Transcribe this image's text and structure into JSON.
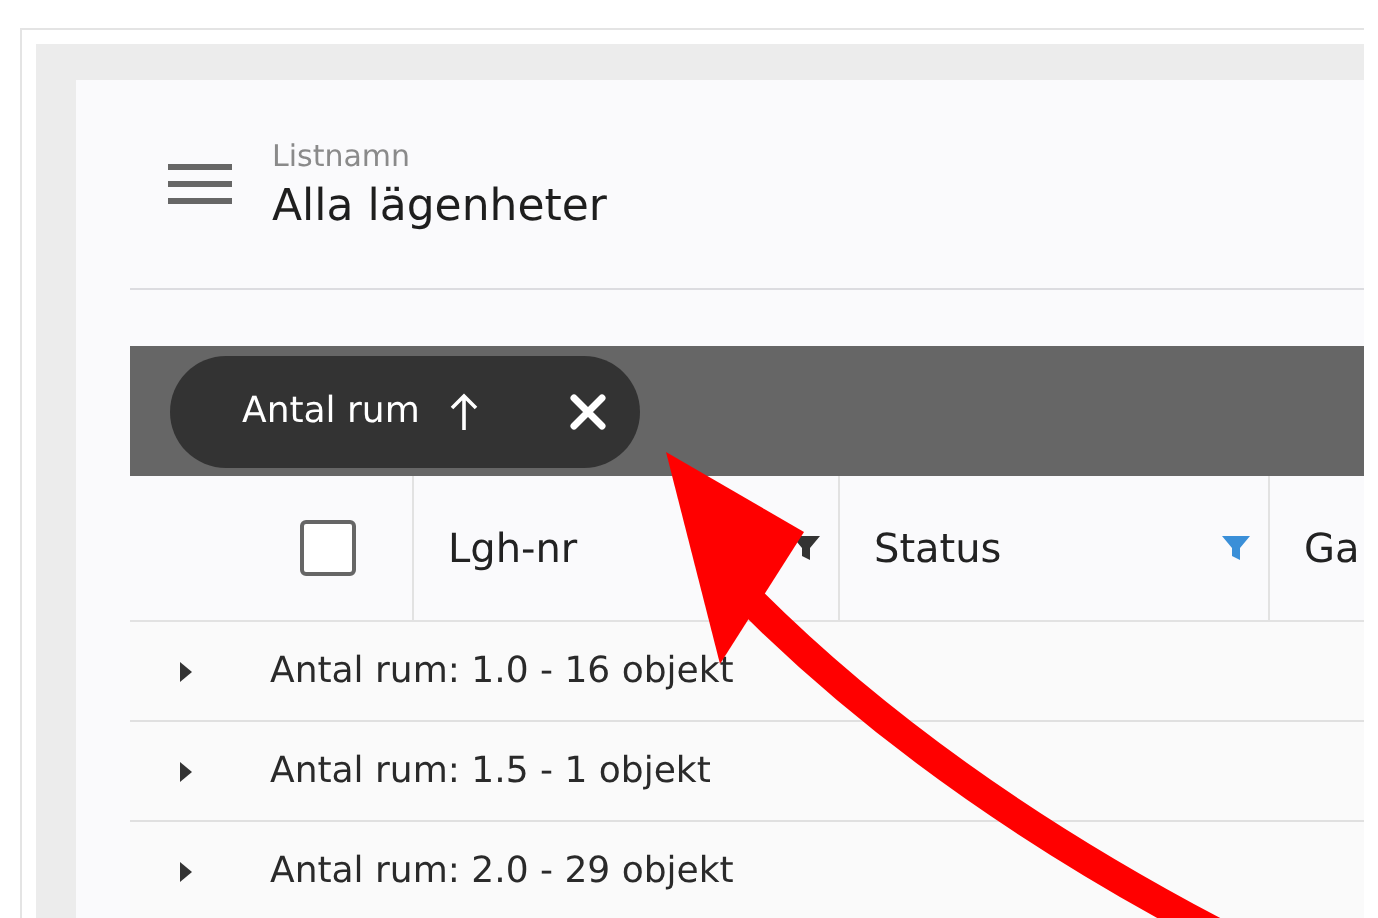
{
  "list_header": {
    "label": "Listnamn",
    "title": "Alla lägenheter"
  },
  "group_bar": {
    "chips": [
      {
        "label": "Antal rum",
        "ascending": true
      }
    ]
  },
  "table": {
    "select_all": {
      "checked": false
    },
    "columns": [
      {
        "label": "Lgh-nr",
        "filtered": false
      },
      {
        "label": "Status",
        "filtered": true
      },
      {
        "label": "Ga"
      }
    ],
    "groups": [
      {
        "label": "Antal rum: 1.0 - 16 objekt",
        "expanded": false
      },
      {
        "label": "Antal rum: 1.5 - 1 objekt",
        "expanded": false
      },
      {
        "label": "Antal rum: 2.0 - 29 objekt",
        "expanded": false
      }
    ]
  },
  "annotation": {
    "kind": "arrow"
  }
}
